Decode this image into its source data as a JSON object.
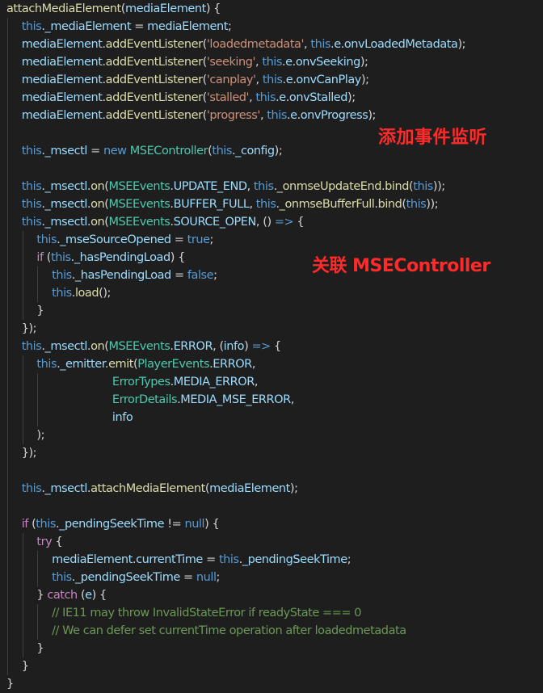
{
  "colors": {
    "default": "#d4d4d4",
    "function": "#dcdcaa",
    "identifier": "#9cdcfe",
    "keyword": "#569cd6",
    "string": "#ce9178",
    "type": "#4ec9b0",
    "comment": "#6a9955",
    "control": "#c586c0",
    "annotation": "#ff2a2a"
  },
  "annotations": {
    "events": "添加事件监听",
    "msectl": "关联 MSEController"
  },
  "lines": [
    {
      "indent": 0,
      "tokens": [
        [
          "attachMediaElement",
          "function"
        ],
        [
          "(",
          ""
        ],
        [
          "mediaElement",
          "identifier"
        ],
        [
          ") {",
          ""
        ]
      ]
    },
    {
      "indent": 1,
      "tokens": [
        [
          "this",
          "keyword"
        ],
        [
          ".",
          ""
        ],
        [
          "_mediaElement",
          "identifier"
        ],
        [
          " = ",
          ""
        ],
        [
          "mediaElement",
          "identifier"
        ],
        [
          ";",
          ""
        ]
      ]
    },
    {
      "indent": 1,
      "tokens": [
        [
          "mediaElement",
          "identifier"
        ],
        [
          ".",
          ""
        ],
        [
          "addEventListener",
          "function"
        ],
        [
          "(",
          ""
        ],
        [
          "'loadedmetadata'",
          "string"
        ],
        [
          ", ",
          ""
        ],
        [
          "this",
          "keyword"
        ],
        [
          ".",
          ""
        ],
        [
          "e",
          "identifier"
        ],
        [
          ".",
          ""
        ],
        [
          "onvLoadedMetadata",
          "identifier"
        ],
        [
          ");",
          ""
        ]
      ]
    },
    {
      "indent": 1,
      "tokens": [
        [
          "mediaElement",
          "identifier"
        ],
        [
          ".",
          ""
        ],
        [
          "addEventListener",
          "function"
        ],
        [
          "(",
          ""
        ],
        [
          "'seeking'",
          "string"
        ],
        [
          ", ",
          ""
        ],
        [
          "this",
          "keyword"
        ],
        [
          ".",
          ""
        ],
        [
          "e",
          "identifier"
        ],
        [
          ".",
          ""
        ],
        [
          "onvSeeking",
          "identifier"
        ],
        [
          ");",
          ""
        ]
      ]
    },
    {
      "indent": 1,
      "tokens": [
        [
          "mediaElement",
          "identifier"
        ],
        [
          ".",
          ""
        ],
        [
          "addEventListener",
          "function"
        ],
        [
          "(",
          ""
        ],
        [
          "'canplay'",
          "string"
        ],
        [
          ", ",
          ""
        ],
        [
          "this",
          "keyword"
        ],
        [
          ".",
          ""
        ],
        [
          "e",
          "identifier"
        ],
        [
          ".",
          ""
        ],
        [
          "onvCanPlay",
          "identifier"
        ],
        [
          ");",
          ""
        ]
      ]
    },
    {
      "indent": 1,
      "tokens": [
        [
          "mediaElement",
          "identifier"
        ],
        [
          ".",
          ""
        ],
        [
          "addEventListener",
          "function"
        ],
        [
          "(",
          ""
        ],
        [
          "'stalled'",
          "string"
        ],
        [
          ", ",
          ""
        ],
        [
          "this",
          "keyword"
        ],
        [
          ".",
          ""
        ],
        [
          "e",
          "identifier"
        ],
        [
          ".",
          ""
        ],
        [
          "onvStalled",
          "identifier"
        ],
        [
          ");",
          ""
        ]
      ]
    },
    {
      "indent": 1,
      "tokens": [
        [
          "mediaElement",
          "identifier"
        ],
        [
          ".",
          ""
        ],
        [
          "addEventListener",
          "function"
        ],
        [
          "(",
          ""
        ],
        [
          "'progress'",
          "string"
        ],
        [
          ", ",
          ""
        ],
        [
          "this",
          "keyword"
        ],
        [
          ".",
          ""
        ],
        [
          "e",
          "identifier"
        ],
        [
          ".",
          ""
        ],
        [
          "onvProgress",
          "identifier"
        ],
        [
          ");",
          ""
        ]
      ]
    },
    {
      "indent": 1,
      "tokens": []
    },
    {
      "indent": 1,
      "tokens": [
        [
          "this",
          "keyword"
        ],
        [
          ".",
          ""
        ],
        [
          "_msectl",
          "identifier"
        ],
        [
          " = ",
          ""
        ],
        [
          "new",
          "keyword"
        ],
        [
          " ",
          ""
        ],
        [
          "MSEController",
          "type"
        ],
        [
          "(",
          ""
        ],
        [
          "this",
          "keyword"
        ],
        [
          ".",
          ""
        ],
        [
          "_config",
          "identifier"
        ],
        [
          ");",
          ""
        ]
      ]
    },
    {
      "indent": 1,
      "tokens": []
    },
    {
      "indent": 1,
      "tokens": [
        [
          "this",
          "keyword"
        ],
        [
          ".",
          ""
        ],
        [
          "_msectl",
          "identifier"
        ],
        [
          ".",
          ""
        ],
        [
          "on",
          "function"
        ],
        [
          "(",
          ""
        ],
        [
          "MSEEvents",
          "type"
        ],
        [
          ".",
          ""
        ],
        [
          "UPDATE_END",
          "identifier"
        ],
        [
          ", ",
          ""
        ],
        [
          "this",
          "keyword"
        ],
        [
          ".",
          ""
        ],
        [
          "_onmseUpdateEnd",
          "function"
        ],
        [
          ".",
          ""
        ],
        [
          "bind",
          "function"
        ],
        [
          "(",
          ""
        ],
        [
          "this",
          "keyword"
        ],
        [
          "));",
          ""
        ]
      ]
    },
    {
      "indent": 1,
      "tokens": [
        [
          "this",
          "keyword"
        ],
        [
          ".",
          ""
        ],
        [
          "_msectl",
          "identifier"
        ],
        [
          ".",
          ""
        ],
        [
          "on",
          "function"
        ],
        [
          "(",
          ""
        ],
        [
          "MSEEvents",
          "type"
        ],
        [
          ".",
          ""
        ],
        [
          "BUFFER_FULL",
          "identifier"
        ],
        [
          ", ",
          ""
        ],
        [
          "this",
          "keyword"
        ],
        [
          ".",
          ""
        ],
        [
          "_onmseBufferFull",
          "function"
        ],
        [
          ".",
          ""
        ],
        [
          "bind",
          "function"
        ],
        [
          "(",
          ""
        ],
        [
          "this",
          "keyword"
        ],
        [
          "));",
          ""
        ]
      ]
    },
    {
      "indent": 1,
      "tokens": [
        [
          "this",
          "keyword"
        ],
        [
          ".",
          ""
        ],
        [
          "_msectl",
          "identifier"
        ],
        [
          ".",
          ""
        ],
        [
          "on",
          "function"
        ],
        [
          "(",
          ""
        ],
        [
          "MSEEvents",
          "type"
        ],
        [
          ".",
          ""
        ],
        [
          "SOURCE_OPEN",
          "identifier"
        ],
        [
          ", () ",
          ""
        ],
        [
          "=>",
          "keyword"
        ],
        [
          " {",
          ""
        ]
      ]
    },
    {
      "indent": 2,
      "tokens": [
        [
          "this",
          "keyword"
        ],
        [
          ".",
          ""
        ],
        [
          "_mseSourceOpened",
          "identifier"
        ],
        [
          " = ",
          ""
        ],
        [
          "true",
          "keyword"
        ],
        [
          ";",
          ""
        ]
      ]
    },
    {
      "indent": 2,
      "tokens": [
        [
          "if",
          "control"
        ],
        [
          " (",
          ""
        ],
        [
          "this",
          "keyword"
        ],
        [
          ".",
          ""
        ],
        [
          "_hasPendingLoad",
          "identifier"
        ],
        [
          ") {",
          ""
        ]
      ]
    },
    {
      "indent": 3,
      "tokens": [
        [
          "this",
          "keyword"
        ],
        [
          ".",
          ""
        ],
        [
          "_hasPendingLoad",
          "identifier"
        ],
        [
          " = ",
          ""
        ],
        [
          "false",
          "keyword"
        ],
        [
          ";",
          ""
        ]
      ]
    },
    {
      "indent": 3,
      "tokens": [
        [
          "this",
          "keyword"
        ],
        [
          ".",
          ""
        ],
        [
          "load",
          "function"
        ],
        [
          "();",
          ""
        ]
      ]
    },
    {
      "indent": 2,
      "tokens": [
        [
          "}",
          ""
        ]
      ]
    },
    {
      "indent": 1,
      "tokens": [
        [
          "});",
          ""
        ]
      ]
    },
    {
      "indent": 1,
      "tokens": [
        [
          "this",
          "keyword"
        ],
        [
          ".",
          ""
        ],
        [
          "_msectl",
          "identifier"
        ],
        [
          ".",
          ""
        ],
        [
          "on",
          "function"
        ],
        [
          "(",
          ""
        ],
        [
          "MSEEvents",
          "type"
        ],
        [
          ".",
          ""
        ],
        [
          "ERROR",
          "identifier"
        ],
        [
          ", (",
          ""
        ],
        [
          "info",
          "identifier"
        ],
        [
          ") ",
          ""
        ],
        [
          "=>",
          "keyword"
        ],
        [
          " {",
          ""
        ]
      ]
    },
    {
      "indent": 2,
      "tokens": [
        [
          "this",
          "keyword"
        ],
        [
          ".",
          ""
        ],
        [
          "_emitter",
          "identifier"
        ],
        [
          ".",
          ""
        ],
        [
          "emit",
          "function"
        ],
        [
          "(",
          ""
        ],
        [
          "PlayerEvents",
          "type"
        ],
        [
          ".",
          ""
        ],
        [
          "ERROR",
          "identifier"
        ],
        [
          ",",
          ""
        ]
      ]
    },
    {
      "indent": 7,
      "tokens": [
        [
          "ErrorTypes",
          "type"
        ],
        [
          ".",
          ""
        ],
        [
          "MEDIA_ERROR",
          "identifier"
        ],
        [
          ",",
          ""
        ]
      ]
    },
    {
      "indent": 7,
      "tokens": [
        [
          "ErrorDetails",
          "type"
        ],
        [
          ".",
          ""
        ],
        [
          "MEDIA_MSE_ERROR",
          "identifier"
        ],
        [
          ",",
          ""
        ]
      ]
    },
    {
      "indent": 7,
      "tokens": [
        [
          "info",
          "identifier"
        ]
      ]
    },
    {
      "indent": 2,
      "tokens": [
        [
          ");",
          ""
        ]
      ]
    },
    {
      "indent": 1,
      "tokens": [
        [
          "});",
          ""
        ]
      ]
    },
    {
      "indent": 1,
      "tokens": []
    },
    {
      "indent": 1,
      "tokens": [
        [
          "this",
          "keyword"
        ],
        [
          ".",
          ""
        ],
        [
          "_msectl",
          "identifier"
        ],
        [
          ".",
          ""
        ],
        [
          "attachMediaElement",
          "function"
        ],
        [
          "(",
          ""
        ],
        [
          "mediaElement",
          "identifier"
        ],
        [
          ");",
          ""
        ]
      ]
    },
    {
      "indent": 1,
      "tokens": []
    },
    {
      "indent": 1,
      "tokens": [
        [
          "if",
          "control"
        ],
        [
          " (",
          ""
        ],
        [
          "this",
          "keyword"
        ],
        [
          ".",
          ""
        ],
        [
          "_pendingSeekTime",
          "identifier"
        ],
        [
          " != ",
          ""
        ],
        [
          "null",
          "keyword"
        ],
        [
          ") {",
          ""
        ]
      ]
    },
    {
      "indent": 2,
      "tokens": [
        [
          "try",
          "control"
        ],
        [
          " {",
          ""
        ]
      ]
    },
    {
      "indent": 3,
      "tokens": [
        [
          "mediaElement",
          "identifier"
        ],
        [
          ".",
          ""
        ],
        [
          "currentTime",
          "identifier"
        ],
        [
          " = ",
          ""
        ],
        [
          "this",
          "keyword"
        ],
        [
          ".",
          ""
        ],
        [
          "_pendingSeekTime",
          "identifier"
        ],
        [
          ";",
          ""
        ]
      ]
    },
    {
      "indent": 3,
      "tokens": [
        [
          "this",
          "keyword"
        ],
        [
          ".",
          ""
        ],
        [
          "_pendingSeekTime",
          "identifier"
        ],
        [
          " = ",
          ""
        ],
        [
          "null",
          "keyword"
        ],
        [
          ";",
          ""
        ]
      ]
    },
    {
      "indent": 2,
      "tokens": [
        [
          "} ",
          ""
        ],
        [
          "catch",
          "control"
        ],
        [
          " (",
          ""
        ],
        [
          "e",
          "identifier"
        ],
        [
          ") {",
          ""
        ]
      ]
    },
    {
      "indent": 3,
      "tokens": [
        [
          "// IE11 may throw InvalidStateError if readyState === 0",
          "comment"
        ]
      ]
    },
    {
      "indent": 3,
      "tokens": [
        [
          "// We can defer set currentTime operation after loadedmetadata",
          "comment"
        ]
      ]
    },
    {
      "indent": 2,
      "tokens": [
        [
          "}",
          ""
        ]
      ]
    },
    {
      "indent": 1,
      "tokens": [
        [
          "}",
          ""
        ]
      ]
    },
    {
      "indent": 0,
      "tokens": [
        [
          "}",
          ""
        ]
      ]
    }
  ]
}
